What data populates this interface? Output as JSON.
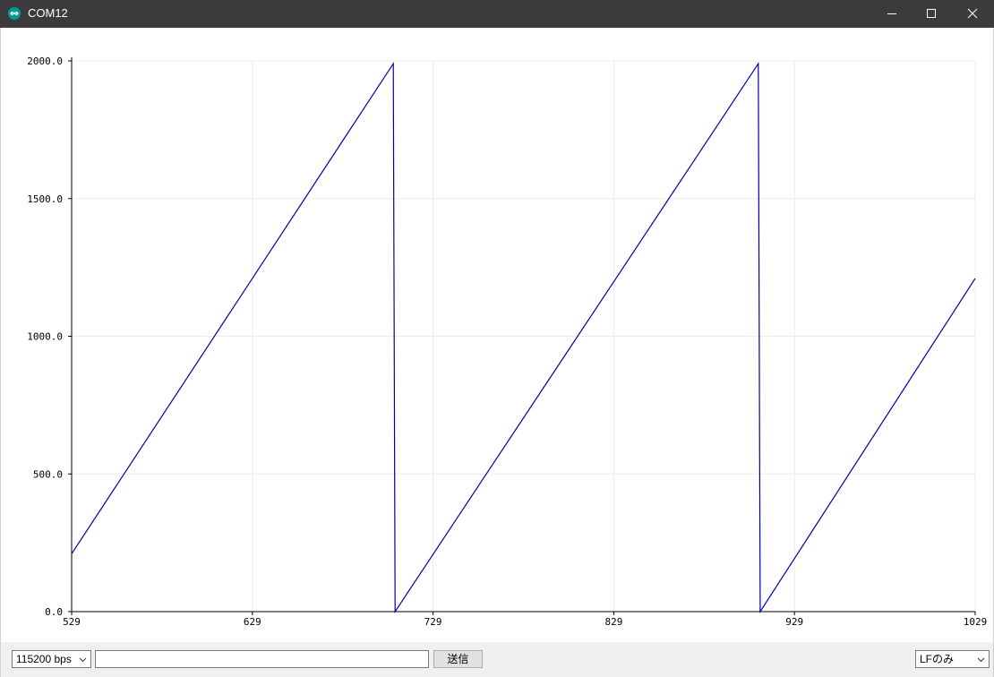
{
  "window": {
    "title": "COM12",
    "icon": "arduino-infinity-icon"
  },
  "titlebar_buttons": {
    "minimize_icon": "minimize-icon",
    "maximize_icon": "maximize-icon",
    "close_icon": "close-icon"
  },
  "chart_data": {
    "type": "line",
    "title": "",
    "xlabel": "",
    "ylabel": "",
    "xlim": [
      529,
      1029
    ],
    "ylim": [
      0,
      2000
    ],
    "x_ticks": [
      "529",
      "629",
      "729",
      "829",
      "929",
      "1029"
    ],
    "y_ticks": [
      "0.0",
      "500.0",
      "1000.0",
      "1500.0",
      "2000.0"
    ],
    "grid": true,
    "legend": "none",
    "series": [
      {
        "color": "#0000aa",
        "points": [
          [
            529,
            210
          ],
          [
            707,
            1990
          ],
          [
            708,
            0
          ],
          [
            909,
            1990
          ],
          [
            910,
            0
          ],
          [
            1029,
            1210
          ]
        ]
      }
    ]
  },
  "bottombar": {
    "baud_rate": "115200 bps",
    "send_input_value": "",
    "send_button_label": "送信",
    "line_ending": "LFのみ"
  },
  "colors": {
    "titlebar": "#3b3b3b",
    "accent": "#00979d",
    "series": "#0000aa",
    "grid": "#ececec"
  }
}
